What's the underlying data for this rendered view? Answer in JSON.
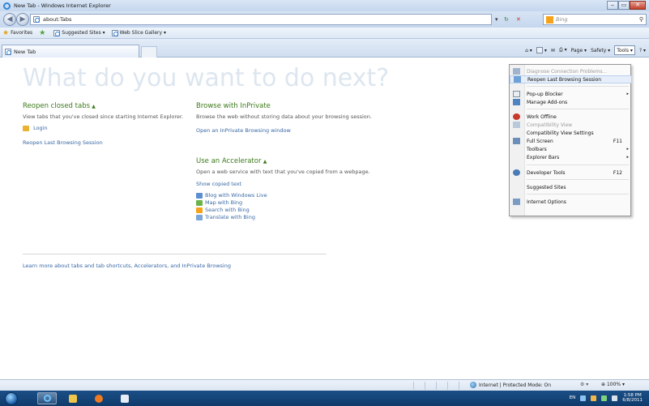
{
  "window": {
    "title": "New Tab - Windows Internet Explorer",
    "min": "‒",
    "max": "▭",
    "close": "✕"
  },
  "address": {
    "url": "about:Tabs",
    "search_placeholder": "Bing",
    "refresh": "↻",
    "stop": "✕",
    "dropdown": "▾",
    "search_button": "⚲"
  },
  "favorites_bar": {
    "favorites_label": "Favorites",
    "items": [
      "Suggested Sites ▾",
      "Web Slice Gallery ▾"
    ]
  },
  "tabs": [
    {
      "label": "New Tab"
    }
  ],
  "command_bar": {
    "page": "Page ▾",
    "safety": "Safety ▾",
    "tools": "Tools ▾",
    "help": "? ▾"
  },
  "main": {
    "heading": "What do you want to do next?",
    "reopen": {
      "title": "Reopen closed tabs",
      "chevron": "▲",
      "desc": "View tabs that you've closed since starting Internet Explorer.",
      "login": "Login",
      "reopen_last": "Reopen Last Browsing Session"
    },
    "inprivate": {
      "title": "Browse with InPrivate",
      "desc": "Browse the web without storing data about your browsing session.",
      "link": "Open an InPrivate Browsing window"
    },
    "accelerator": {
      "title": "Use an Accelerator",
      "chevron": "▲",
      "desc": "Open a web service with text that you've copied from a webpage.",
      "show_copied": "Show copied text",
      "items": [
        "Blog with Windows Live",
        "Map with Bing",
        "Search with Bing",
        "Translate with Bing"
      ]
    },
    "learn_more": "Learn more about tabs and tab shortcuts, Accelerators, and InPrivate Browsing"
  },
  "tools_menu": {
    "items": [
      {
        "label": "Diagnose Connection Problems...",
        "disabled": true
      },
      {
        "label": "Reopen Last Browsing Session"
      },
      {
        "label": "Pop-up Blocker",
        "submenu": true
      },
      {
        "label": "Manage Add-ons"
      },
      {
        "label": "Work Offline"
      },
      {
        "label": "Compatibility View",
        "disabled": true
      },
      {
        "label": "Compatibility View Settings"
      },
      {
        "label": "Full Screen",
        "shortcut": "F11"
      },
      {
        "label": "Toolbars",
        "submenu": true
      },
      {
        "label": "Explorer Bars",
        "submenu": true
      },
      {
        "label": "Developer Tools",
        "shortcut": "F12"
      },
      {
        "label": "Suggested Sites"
      },
      {
        "label": "Internet Options"
      }
    ],
    "arrow": "▸"
  },
  "status_bar": {
    "zone": "Internet | Protected Mode: On",
    "zoom": "100%",
    "zoom_arrow": "▾"
  },
  "taskbar": {
    "lang": "EN",
    "time": "1:58 PM",
    "date": "6/8/2011"
  },
  "colors": {
    "accent_link": "#3868a5",
    "section_title": "#3b7a1a",
    "taskbar": "#1b4f86"
  }
}
